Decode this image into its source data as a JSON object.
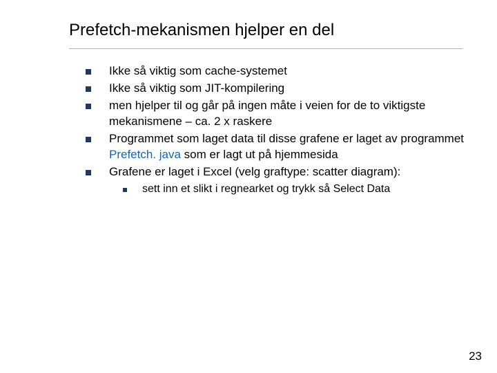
{
  "title": "Prefetch-mekanismen hjelper en del",
  "bullets": [
    {
      "text": "Ikke så viktig som cache-systemet"
    },
    {
      "text": "Ikke så viktig som JIT-kompilering"
    },
    {
      "text": "men hjelper til og går på ingen måte i veien for de to viktigste mekanismene – ca. 2 x raskere"
    },
    {
      "pre": "Programmet som laget data til disse grafene er laget av programmet ",
      "link": "Prefetch. java ",
      "post": "som er lagt ut på hjemmesida"
    },
    {
      "text": "Grafene er laget i Excel (velg graftype: scatter diagram):",
      "sub": [
        "sett inn et slikt i regnearket og trykk så Select Data"
      ]
    }
  ],
  "page_number": "23"
}
